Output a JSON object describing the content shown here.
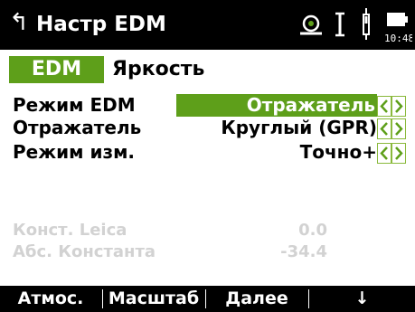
{
  "header": {
    "title": "Настр EDM",
    "time": "10:48",
    "icons": [
      "back-icon",
      "prism-target-icon",
      "laser-beam-icon",
      "bubble-level-icon",
      "battery-icon"
    ]
  },
  "tabs": [
    {
      "label": "EDM",
      "active": true
    },
    {
      "label": "Яркость",
      "active": false
    }
  ],
  "fields": [
    {
      "label": "Режим EDM",
      "value": "Отражатель"
    },
    {
      "label": "Отражатель",
      "value": "Круглый (GPR)"
    },
    {
      "label": "Режим изм.",
      "value": "Точно+"
    }
  ],
  "readonly_fields": [
    {
      "label": "Конст. Leica",
      "value": "0.0"
    },
    {
      "label": "Абс. Константа",
      "value": "-34.4"
    }
  ],
  "softkeys": [
    "Атмос.",
    "Масштаб",
    "Далее",
    "↓"
  ],
  "colors": {
    "accent": "#5e9f1a",
    "titlebar": "#000000",
    "disabled_text": "#d2d2d2"
  }
}
